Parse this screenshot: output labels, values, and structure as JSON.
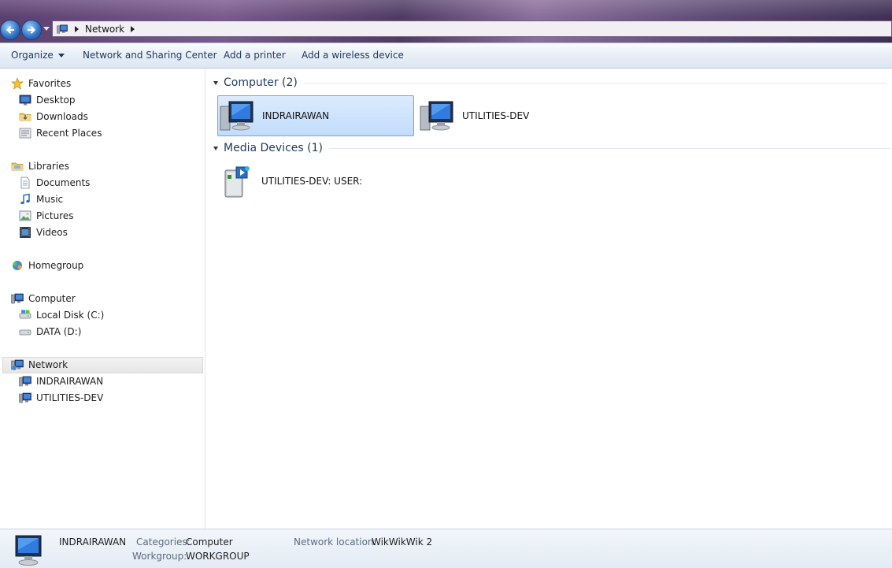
{
  "address": {
    "crumbs": [
      "Network"
    ]
  },
  "toolbar": {
    "organize": "Organize",
    "network_sharing": "Network and Sharing Center",
    "add_printer": "Add a printer",
    "add_wireless": "Add a wireless device"
  },
  "nav": {
    "favorites": "Favorites",
    "desktop": "Desktop",
    "downloads": "Downloads",
    "recent": "Recent Places",
    "libraries": "Libraries",
    "documents": "Documents",
    "music": "Music",
    "pictures": "Pictures",
    "videos": "Videos",
    "homegroup": "Homegroup",
    "computer": "Computer",
    "local_disk": "Local Disk (C:)",
    "data": "DATA (D:)",
    "network": "Network",
    "net_child_1": "INDRAIRAWAN",
    "net_child_2": "UTILITIES-DEV"
  },
  "content": {
    "computer_group": "Computer (2)",
    "computers": [
      "INDRAIRAWAN",
      "UTILITIES-DEV"
    ],
    "media_group": "Media Devices (1)",
    "media": [
      "UTILITIES-DEV: USER:"
    ]
  },
  "details": {
    "name": "INDRAIRAWAN",
    "categories_label": "Categories:",
    "categories_value": "Computer",
    "workgroup_label": "Workgroup:",
    "workgroup_value": "WORKGROUP",
    "network_location_label": "Network location:",
    "network_location_value": "WikWikWik  2"
  },
  "colors": {
    "accent": "#1e395b",
    "selection": "#c1dcfc"
  },
  "icons": [
    "back-arrow-icon",
    "forward-arrow-icon",
    "network-globe-icon",
    "star-icon",
    "monitor-icon",
    "folder-icon",
    "library-icon",
    "document-icon",
    "music-note-icon",
    "picture-icon",
    "video-icon",
    "homegroup-icon",
    "computer-icon",
    "drive-icon",
    "media-device-icon"
  ]
}
